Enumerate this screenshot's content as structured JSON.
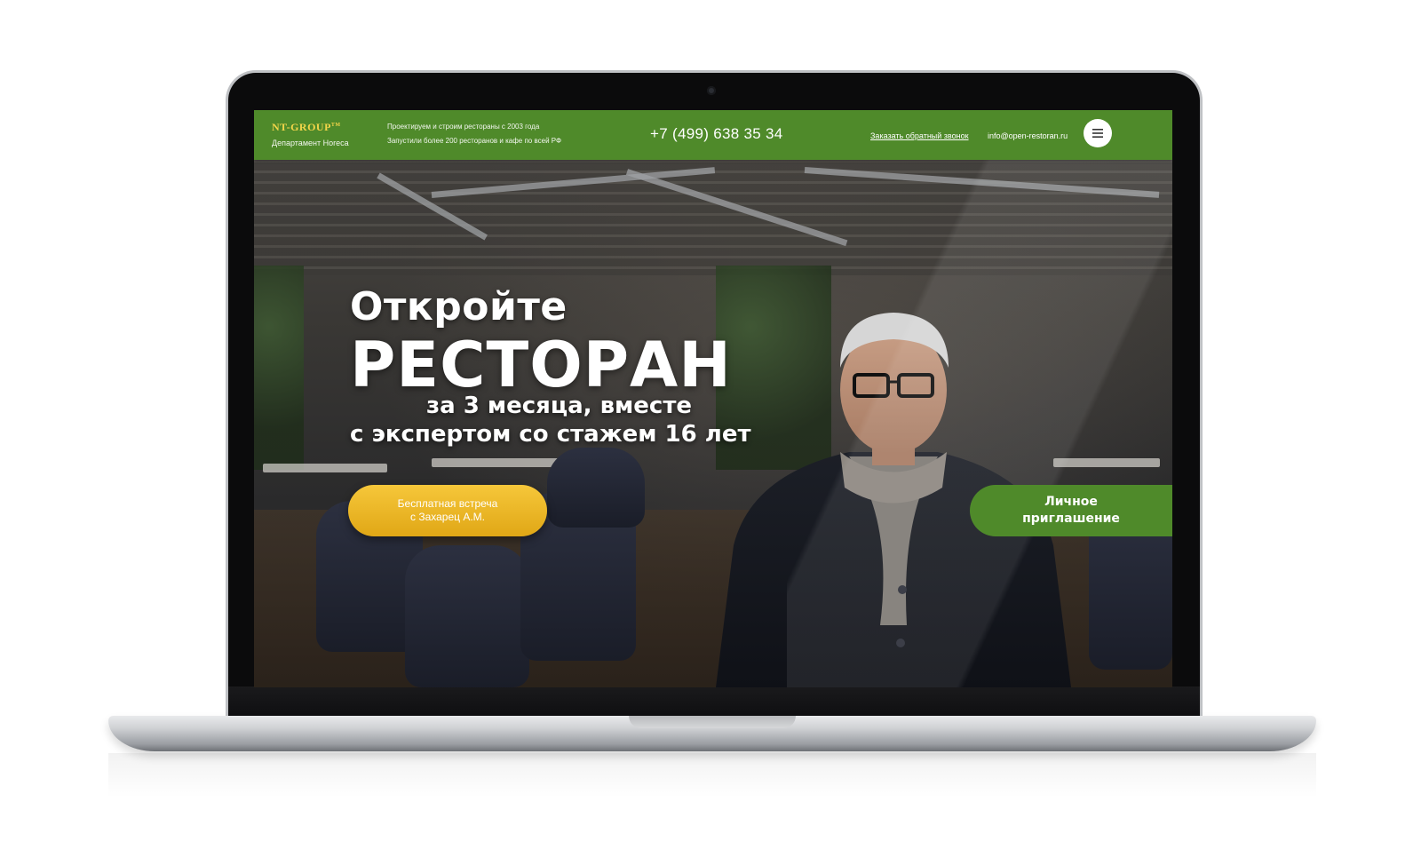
{
  "header": {
    "logo_text": "NT-GROUP",
    "logo_tm": "TM",
    "logo_subtitle": "Департамент Horeca",
    "tagline_1": "Проектируем и строим рестораны с 2003 года",
    "tagline_2": "Запустили более 200 ресторанов и кафе по всей РФ",
    "phone": "+7 (499) 638 35 34",
    "callback_link": "Заказать обратный звонок",
    "email": "info@open-restoran.ru",
    "menu_icon": "hamburger-icon"
  },
  "hero": {
    "line_1": "Откройте",
    "line_2": "РЕСТОРАН",
    "line_3": "за 3 месяца, вместе",
    "line_4": "с экспертом со стажем 16 лет",
    "cta_meeting_line_1": "Бесплатная встреча",
    "cta_meeting_line_2": "с Захарец А.М.",
    "cta_invite_line_1": "Личное",
    "cta_invite_line_2": "приглашение"
  },
  "colors": {
    "header_green": "#4f8a2a",
    "cta_yellow": "#f6c73a",
    "logo_gold": "#f3d54a"
  }
}
